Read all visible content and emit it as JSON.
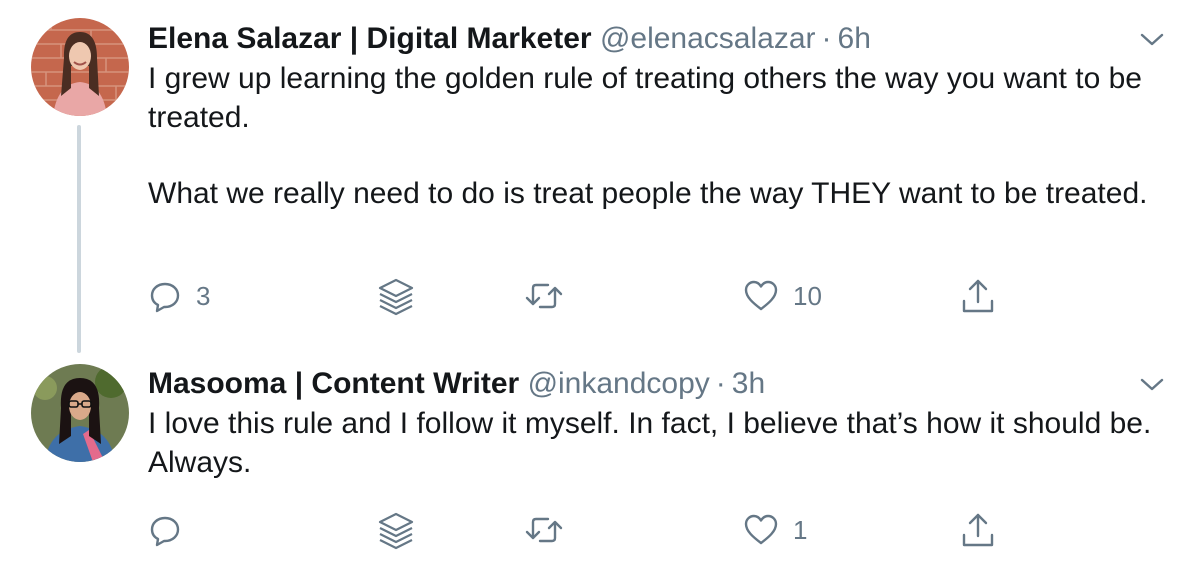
{
  "tweets": [
    {
      "name": "Elena Salazar | Digital Marketer",
      "handle": "@elenacsalazar",
      "separator": "·",
      "time": "6h",
      "paragraphs": [
        "I grew up learning the golden rule of treating others the way you want to be treated.",
        "What we really need to do is treat people the way THEY want to be treated."
      ],
      "reply_count": "3",
      "like_count": "10"
    },
    {
      "name": "Masooma | Content Writer",
      "handle": "@inkandcopy",
      "separator": "·",
      "time": "3h",
      "paragraphs": [
        "I love this rule and I follow it myself. In fact, I believe that’s how it should be. Always."
      ],
      "reply_count": "",
      "like_count": "1"
    }
  ],
  "icons": {
    "reply": "speech-bubble",
    "layers": "stacked-layers",
    "retweet": "retweet-arrows",
    "like": "heart",
    "share": "upload-arrow",
    "menu": "chevron-down"
  },
  "colors": {
    "text": "#14171a",
    "secondary": "#657786",
    "thread_line": "#ccd6dd"
  }
}
